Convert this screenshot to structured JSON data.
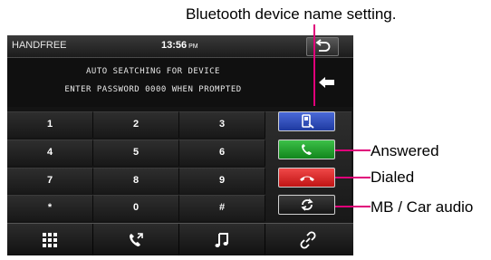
{
  "annotations": {
    "bluetooth_name": "Bluetooth device name setting.",
    "answered": "Answered",
    "dialed": "Dialed",
    "mb_car_audio": "MB / Car audio"
  },
  "status_bar": {
    "title": "HANDFREE",
    "time": "13:56",
    "ampm": "PM"
  },
  "message": {
    "line1": "AUTO SEATCHING FOR DEVICE",
    "line2": "ENTER PASSWORD 0000 WHEN PROMPTED"
  },
  "keypad": [
    "1",
    "2",
    "3",
    "4",
    "5",
    "6",
    "7",
    "8",
    "9",
    "*",
    "0",
    "#"
  ],
  "side_buttons": [
    {
      "name": "bluetooth-name-button",
      "icon": "phone-settings-icon",
      "color": "#2f4fc0"
    },
    {
      "name": "answered-button",
      "icon": "phone-answer-icon",
      "color": "#22a52e"
    },
    {
      "name": "dialed-button",
      "icon": "phone-hangup-icon",
      "color": "#dd2a2a"
    },
    {
      "name": "mb-car-audio-button",
      "icon": "switch-audio-icon",
      "color": "#222222"
    }
  ],
  "bottom_nav": [
    "keypad-icon",
    "call-log-icon",
    "music-note-icon",
    "link-icon"
  ],
  "colors": {
    "callout_line": "#e0007a",
    "screen_bg": "#141414"
  }
}
